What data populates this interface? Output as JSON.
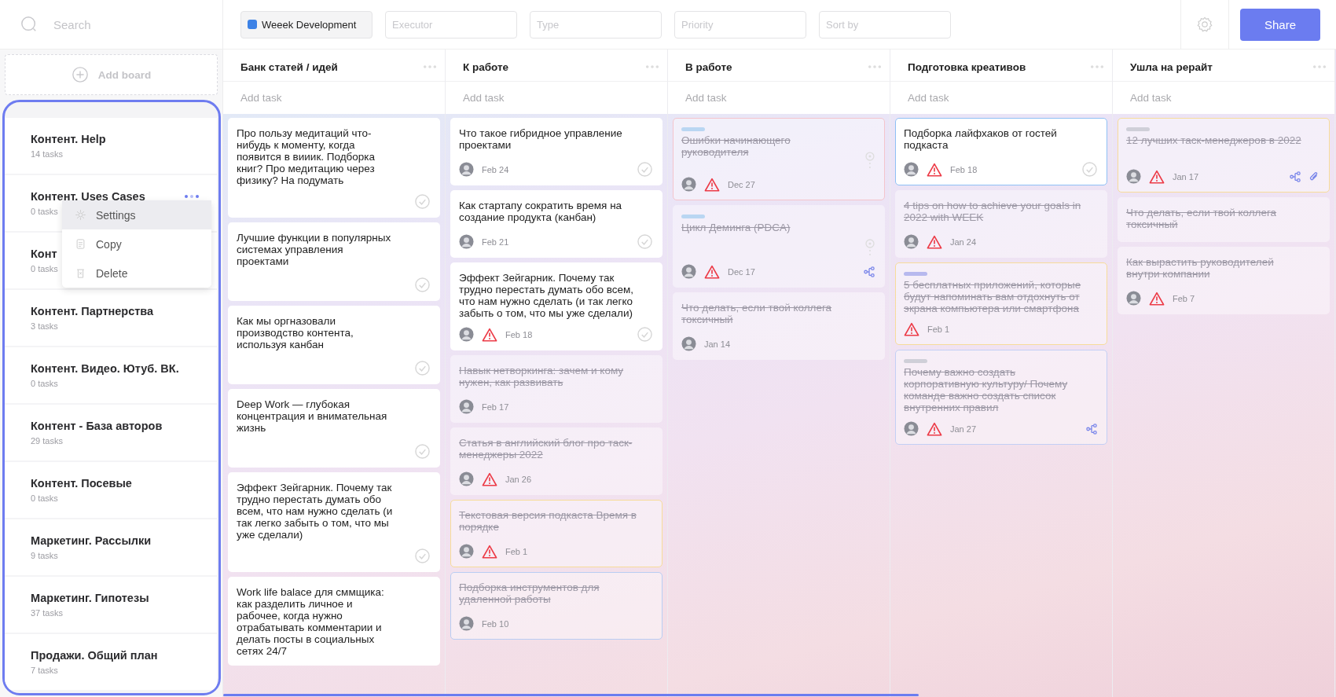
{
  "search": {
    "placeholder": "Search"
  },
  "add_board": {
    "label": "Add board"
  },
  "boards": [
    {
      "name": "Контент. Help",
      "count": "14 tasks",
      "menu_open": false
    },
    {
      "name": "Контент. Uses Cases",
      "count": "0 tasks",
      "menu_open": true
    },
    {
      "name": "Конт",
      "count": "0 tasks",
      "menu_open": false
    },
    {
      "name": "Контент. Партнерства",
      "count": "3 tasks",
      "menu_open": false
    },
    {
      "name": "Контент. Видео. Ютуб. ВК.",
      "count": "0 tasks",
      "menu_open": false
    },
    {
      "name": "Контент - База авторов",
      "count": "29 tasks",
      "menu_open": false
    },
    {
      "name": "Контент. Посевые",
      "count": "0 tasks",
      "menu_open": false
    },
    {
      "name": "Маркетинг. Рассылки",
      "count": "9 tasks",
      "menu_open": false
    },
    {
      "name": "Маркетинг. Гипотезы",
      "count": "37 tasks",
      "menu_open": false
    },
    {
      "name": "Продажи. Общий план",
      "count": "7 tasks",
      "menu_open": false
    }
  ],
  "board_menu": {
    "items": [
      {
        "kind": "settings",
        "label": "Settings",
        "selected": true
      },
      {
        "kind": "copy",
        "label": "Copy",
        "selected": false
      },
      {
        "kind": "delete",
        "label": "Delete",
        "selected": false
      }
    ]
  },
  "project": {
    "label": "Weeek Development",
    "color": "#3d82e6"
  },
  "filters": [
    {
      "placeholder": "Executor"
    },
    {
      "placeholder": "Type"
    },
    {
      "placeholder": "Priority"
    },
    {
      "placeholder": "Sort by"
    }
  ],
  "share_button": {
    "label": "Share"
  },
  "columns": [
    {
      "title": "Банк статей / идей",
      "add_placeholder": "Add task",
      "cards": [
        {
          "title": "Про пользу медитаций что-нибудь к моменту, когда появится в вииик. Подборка книг? Про медитацию через физику? На подумать",
          "done": false,
          "check": true
        },
        {
          "title": "Лучшие функции в популярных системах управления проектами",
          "done": false,
          "check": true
        },
        {
          "title": "Как мы оргназовали производство контента, используя канбан",
          "done": false,
          "check": true
        },
        {
          "title": "Deep Work — глубокая концентрация и внимательная жизнь",
          "done": false,
          "check": true
        },
        {
          "title": "Эффект Зейгарник. Почему так трудно перестать думать обо всем, что нам нужно сделать (и так легко забыть о том, что мы уже сделали)",
          "done": false,
          "check": true
        },
        {
          "title": "Work life balace для сммщика: как разделить личное и рабочее, когда нужно отрабатывать комментарии и делать посты в социальных сетях 24/7",
          "done": false,
          "check": false
        }
      ]
    },
    {
      "title": "К работе",
      "add_placeholder": "Add task",
      "cards": [
        {
          "title": "Что такое гибридное управление проектами",
          "done": false,
          "avatar": true,
          "date": "Feb 24",
          "check": true
        },
        {
          "title": "Как стартапу сократить время на создание продукта (канбан)",
          "done": false,
          "avatar": true,
          "date": "Feb 21",
          "check": true
        },
        {
          "title": "Эффект Зейгарник. Почему так трудно перестать думать обо всем, что нам нужно сделать (и так легко забыть о том, что мы уже сделали)",
          "done": false,
          "avatar": true,
          "high_priority": true,
          "date": "Feb 18",
          "check": true
        },
        {
          "title": "Навык нетворкинга: зачем и кому нужен, как развивать",
          "done": true,
          "avatar": true,
          "date": "Feb 17"
        },
        {
          "title": "Статья в английский блог про таск-менеджеры 2022",
          "done": true,
          "avatar": true,
          "high_priority": true,
          "date": "Jan 26"
        },
        {
          "title": "Текстовая версия подкаста Время в порядке",
          "done": true,
          "outline": {
            "color": "#f7dc9a"
          },
          "avatar": true,
          "high_priority": true,
          "date": "Feb 1"
        },
        {
          "title": "Подборка инструментов для удаленной работы",
          "done": true,
          "outline": {
            "color": "#b9cdf3"
          },
          "avatar": true,
          "date": "Feb 10"
        }
      ]
    },
    {
      "title": "В работе",
      "add_placeholder": "Add task",
      "cards": [
        {
          "title": "Ошибки начинающего руководителя",
          "done": true,
          "tag": {
            "color": "#b9d6f2"
          },
          "outline": {
            "color": "#f4c4cc"
          },
          "timer": true,
          "avatar": true,
          "high_priority": true,
          "date": "Dec 27"
        },
        {
          "title": "Цикл Деминга (PDCA)",
          "done": true,
          "tag": {
            "color": "#b9d6f2"
          },
          "timer": true,
          "avatar": true,
          "high_priority": true,
          "date": "Dec 17",
          "subtasks": true
        },
        {
          "title": "Что делать, если твой коллега токсичный",
          "done": true,
          "avatar": true,
          "date": "Jan 14"
        }
      ]
    },
    {
      "title": "Подготовка креативов",
      "add_placeholder": "Add task",
      "cards": [
        {
          "title": "Подборка лайфхаков от гостей подкаста",
          "done": false,
          "outline": {
            "color": "#8ec0f5"
          },
          "avatar": true,
          "high_priority": true,
          "date": "Feb 18",
          "check": true
        },
        {
          "title": "4 tips on how to achieve your goals in 2022 with WEEK",
          "done": true,
          "avatar": true,
          "high_priority": true,
          "date": "Jan 24"
        },
        {
          "title": "5 бесплатных приложений, которые будут напоминать вам отдохнуть от экрана компьютера или смартфона",
          "done": true,
          "tag": {
            "color": "#b7b9ee"
          },
          "outline": {
            "color": "#f7dc9a"
          },
          "high_priority": true,
          "date": "Feb 1"
        },
        {
          "title": "Почему важно создать корпоративную культуру/ Почему команде важно создать список внутренних правил",
          "done": true,
          "tag": {
            "color": "#cfcfd8"
          },
          "outline": {
            "color": "#c3cff5"
          },
          "avatar": true,
          "high_priority": true,
          "date": "Jan 27",
          "subtasks": true
        }
      ]
    },
    {
      "title": "Ушла на рерайт",
      "add_placeholder": "Add task",
      "cards": [
        {
          "title": "12 лучших таск-менеджеров в 2022",
          "done": true,
          "tag": {
            "color": "#cfcfd8"
          },
          "outline": {
            "color": "#f7dc9a"
          },
          "avatar": true,
          "high_priority": true,
          "date": "Jan 17",
          "subtasks": true,
          "attachment": true
        },
        {
          "title": "Что делать, если твой коллега токсичный",
          "done": true
        },
        {
          "title": "Как вырастить руководителей внутри компании",
          "done": true,
          "avatar": true,
          "high_priority": true,
          "date": "Feb 7"
        }
      ]
    }
  ]
}
